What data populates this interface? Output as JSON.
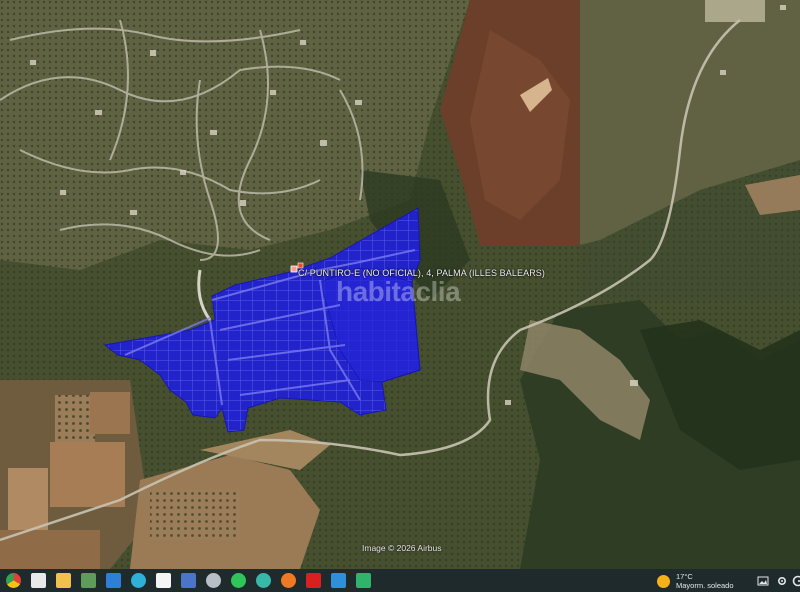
{
  "map": {
    "address_label": "C/ PUNTIRO-E (NO OFICIAL), 4, PALMA (ILLES BALEARS)",
    "watermark": "habitaclia",
    "imagery_credit": "Image © 2026 Airbus",
    "parcel_color": "#1f1fd9"
  },
  "taskbar": {
    "items": [
      {
        "name": "chrome",
        "icon": "chrome-icon",
        "color": "#e44134"
      },
      {
        "name": "app",
        "icon": "app-icon",
        "color": "#e9e9e9"
      },
      {
        "name": "file-explorer",
        "icon": "folder-icon",
        "color": "#f2c14b"
      },
      {
        "name": "app-2",
        "icon": "app-icon",
        "color": "#5f9b5a"
      },
      {
        "name": "photos",
        "icon": "photos-icon",
        "color": "#2f7fd8"
      },
      {
        "name": "edge",
        "icon": "edge-icon",
        "color": "#2fb0d8"
      },
      {
        "name": "document",
        "icon": "document-icon",
        "color": "#f4f4f4"
      },
      {
        "name": "app-3",
        "icon": "app-icon",
        "color": "#4c74c9"
      },
      {
        "name": "cd",
        "icon": "cd-icon",
        "color": "#b8bfc6"
      },
      {
        "name": "whatsapp",
        "icon": "whatsapp-icon",
        "color": "#2fc55b"
      },
      {
        "name": "app-4",
        "icon": "app-icon",
        "color": "#38b8a8"
      },
      {
        "name": "firefox",
        "icon": "firefox-icon",
        "color": "#f07a24"
      },
      {
        "name": "acrobat",
        "icon": "acrobat-icon",
        "color": "#d92020"
      },
      {
        "name": "app-5",
        "icon": "app-icon",
        "color": "#2f8fd8"
      },
      {
        "name": "app-6",
        "icon": "app-icon",
        "color": "#30b46c"
      }
    ],
    "weather": {
      "temp": "17°C",
      "desc": "Mayorm. soleado"
    }
  }
}
